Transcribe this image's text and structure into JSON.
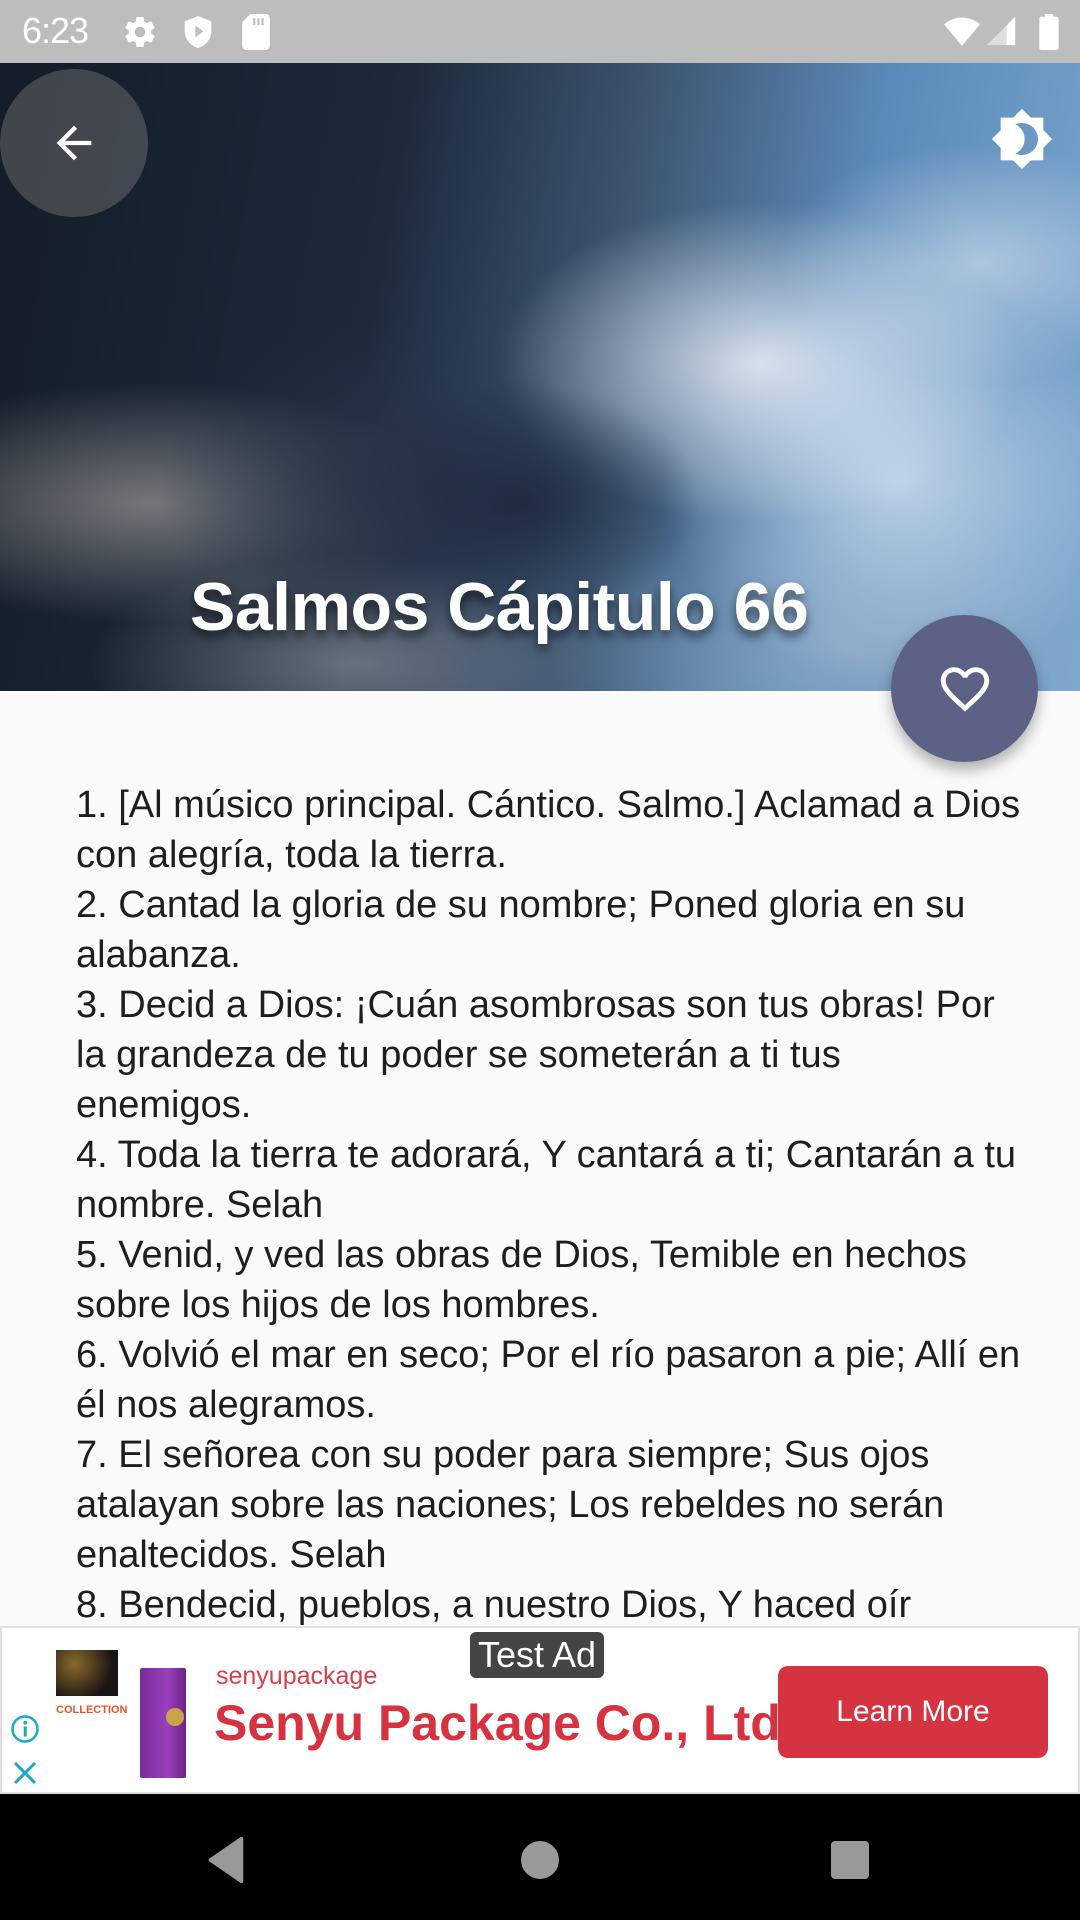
{
  "status_bar": {
    "time": "6:23",
    "icons": [
      "gear-icon",
      "shield-play-icon",
      "sd-card-icon",
      "wifi-icon",
      "cell-signal-icon",
      "battery-icon"
    ]
  },
  "header": {
    "title": "Salmos Cápitulo 66",
    "back_icon": "arrow-left-icon",
    "theme_icon": "brightness-toggle-icon"
  },
  "fab": {
    "icon": "heart-outline-icon"
  },
  "verses": [
    "1. [Al músico principal. Cántico. Salmo.] Aclamad a Dios con alegría, toda la tierra.",
    "2. Cantad la gloria de su nombre; Poned gloria en su alabanza.",
    "3. Decid a Dios: ¡Cuán asombrosas son tus obras! Por la grandeza de tu poder se someterán a ti tus enemigos.",
    "4. Toda la tierra te adorará, Y cantará a ti; Cantarán a tu nombre. Selah",
    "5. Venid, y ved las obras de Dios, Temible en hechos sobre los hijos de los hombres.",
    "6. Volvió el mar en seco; Por el río pasaron a pie; Allí en él nos alegramos.",
    "7. El señorea con su poder para siempre; Sus ojos atalayan sobre las naciones; Los rebeldes no serán enaltecidos. Selah",
    "8. Bendecid, pueblos, a nuestro Dios, Y haced oír"
  ],
  "ad": {
    "badge": "Test Ad",
    "thumb_caption": "COLLECTION",
    "advertiser": "senyupackage",
    "headline": "Senyu Package Co., Ltd",
    "cta": "Learn More",
    "accent_color": "#d63341",
    "info_icon": "info-icon",
    "close_icon": "close-icon"
  },
  "nav_bar": {
    "buttons": [
      "back",
      "home",
      "recents"
    ]
  },
  "colors": {
    "fab": "#5d6185",
    "status_bar": "#bdbdbd",
    "background": "#fafafa",
    "ad_icons": "#1aa9c9"
  }
}
